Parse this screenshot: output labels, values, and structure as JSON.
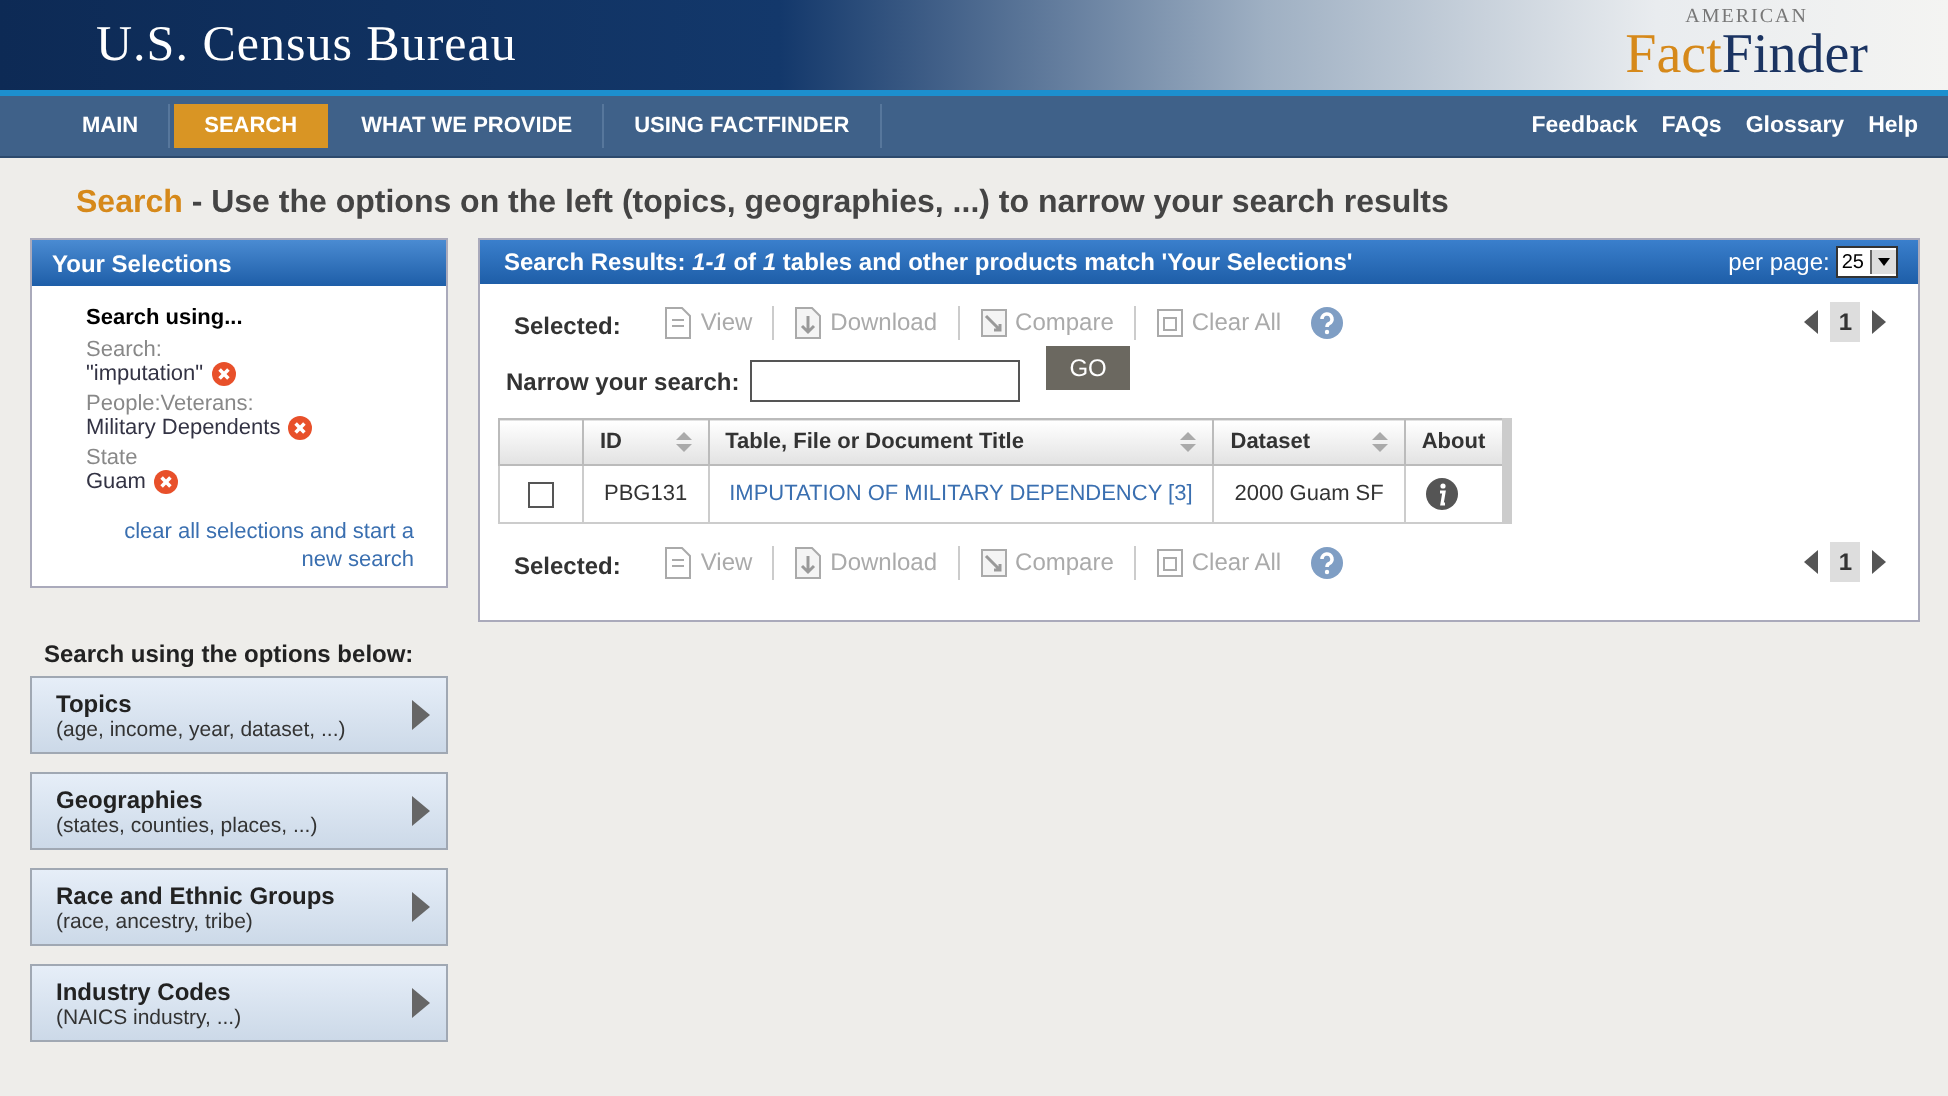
{
  "header": {
    "title": "U.S. Census Bureau",
    "logo": {
      "top": "AMERICAN",
      "part_1": "Fact",
      "part_2": "Finder"
    }
  },
  "nav": {
    "items": [
      {
        "label": "MAIN",
        "selected": false
      },
      {
        "label": "SEARCH",
        "selected": true
      },
      {
        "label": "WHAT WE PROVIDE",
        "selected": false
      },
      {
        "label": "USING FACTFINDER",
        "selected": false
      }
    ],
    "links": [
      "Feedback",
      "FAQs",
      "Glossary",
      "Help"
    ]
  },
  "page_title": {
    "lead": "Search",
    "rest": "- Use the options on the left (topics, geographies, ...) to narrow your search results"
  },
  "selections": {
    "title": "Your Selections",
    "heading": "Search using...",
    "groups": [
      {
        "label": "Search:",
        "value": "\"imputation\""
      },
      {
        "label": "People:Veterans:",
        "value": "Military Dependents"
      },
      {
        "label": "State",
        "value": "Guam"
      }
    ],
    "clear_link": "clear all selections and start a new search"
  },
  "options": {
    "heading": "Search using the options below:",
    "items": [
      {
        "title": "Topics",
        "hint": "(age, income, year, dataset, ...)"
      },
      {
        "title": "Geographies",
        "hint": "(states, counties, places, ...)"
      },
      {
        "title": "Race and Ethnic Groups",
        "hint": "(race, ancestry, tribe)"
      },
      {
        "title": "Industry Codes",
        "hint": "(NAICS industry, ...)"
      }
    ]
  },
  "results": {
    "summary": "Search Results:  *1-1* of *1* tables and other products match 'Your Selections'",
    "per_page_label": "per page:",
    "per_page": "25",
    "toolbar": {
      "label": "Selected:",
      "actions": [
        {
          "kind": "view",
          "label": "View",
          "disabled": true
        },
        {
          "kind": "download",
          "label": "Download",
          "disabled": true
        },
        {
          "kind": "compare",
          "label": "Compare",
          "disabled": true
        },
        {
          "kind": "clear",
          "label": "Clear All",
          "disabled": true
        }
      ],
      "pages": [
        {
          "label": "1",
          "selected": true
        }
      ]
    },
    "narrow": {
      "label": "Narrow your search:",
      "button": "GO"
    },
    "table": {
      "columns": [
        {
          "label": "ID",
          "sortable": true
        },
        {
          "label": "Table, File or Document Title",
          "sortable": true
        },
        {
          "label": "Dataset",
          "sortable": true
        },
        {
          "label": "About",
          "sortable": false
        }
      ],
      "rows": [
        {
          "checked": false,
          "id": "PBG131",
          "title": "IMPUTATION OF MILITARY DEPENDENCY [3]",
          "dataset": "2000 Guam SF"
        }
      ]
    },
    "bottom_toolbar": {
      "label": "Selected:",
      "actions": [
        {
          "kind": "view",
          "label": "View",
          "disabled": true
        },
        {
          "kind": "download",
          "label": "Download",
          "disabled": true
        },
        {
          "kind": "compare",
          "label": "Compare",
          "disabled": true
        },
        {
          "kind": "clear",
          "label": "Clear All",
          "disabled": true
        }
      ],
      "pages": [
        {
          "label": "1",
          "selected": true
        }
      ]
    }
  }
}
